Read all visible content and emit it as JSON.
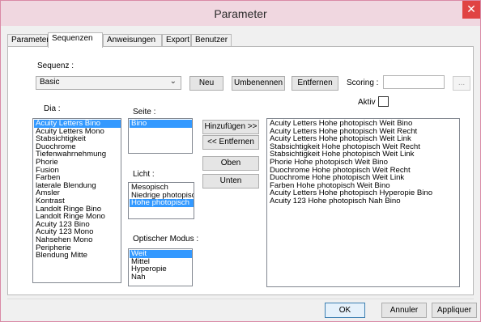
{
  "window": {
    "title": "Parameter",
    "close_glyph": "✕"
  },
  "tabs": [
    "Parameter",
    "Sequenzen",
    "Anweisungen",
    "Export",
    "Benutzer"
  ],
  "active_tab": "Sequenzen",
  "sequenz": {
    "label": "Sequenz :",
    "value": "Basic",
    "neu": "Neu",
    "umbenennen": "Umbenennen",
    "entfernen": "Entfernen",
    "scoring_label": "Scoring :",
    "scoring_value": "",
    "scoring_button": "...",
    "aktiv_label": "Aktiv",
    "aktiv_checked": false
  },
  "dia": {
    "label": "Dia :",
    "items": [
      "Acuity Letters Bino",
      "Acuity Letters Mono",
      "Stabsichtigkeit",
      "Duochrome",
      "Tiefenwahrnehmung",
      "Phorie",
      "Fusion",
      "Farben",
      "laterale Blendung",
      "Amsler",
      "Kontrast",
      "Landolt Ringe Bino",
      "Landolt Ringe Mono",
      "Acuity 123 Bino",
      "Acuity 123 Mono",
      "Nahsehen Mono",
      "Peripherie",
      "Blendung Mitte"
    ],
    "selected": 0
  },
  "seite": {
    "label": "Seite :",
    "items": [
      "Bino"
    ],
    "selected": 0
  },
  "licht": {
    "label": "Licht :",
    "items": [
      "Mesopisch",
      "Niedrige photopisch",
      "Hohe photopisch"
    ],
    "selected": 2
  },
  "modus": {
    "label": "Optischer Modus :",
    "items": [
      "Weit",
      "Mittel",
      "Hyperopie",
      "Nah"
    ],
    "selected": 0
  },
  "actions": {
    "hinzufuegen": "Hinzufügen >>",
    "entfernen": "<< Entfernen",
    "oben": "Oben",
    "unten": "Unten"
  },
  "sequence_list": [
    "Acuity Letters  Hohe photopisch  Weit  Bino",
    "Acuity Letters  Hohe photopisch  Weit  Recht",
    "Acuity Letters  Hohe photopisch  Weit  Link",
    "Stabsichtigkeit  Hohe photopisch  Weit  Recht",
    "Stabsichtigkeit  Hohe photopisch  Weit  Link",
    "Phorie  Hohe photopisch  Weit  Bino",
    "Duochrome  Hohe photopisch  Weit  Recht",
    "Duochrome  Hohe photopisch  Weit  Link",
    "Farben  Hohe photopisch  Weit  Bino",
    "Acuity Letters  Hohe photopisch  Hyperopie  Bino",
    "Acuity 123  Hohe photopisch  Nah  Bino"
  ],
  "footer": {
    "ok": "OK",
    "annuler": "Annuler",
    "appliquer": "Appliquer"
  },
  "colors": {
    "selection": "#3399ff",
    "titlebar": "#f0d7e0",
    "close": "#e04343"
  }
}
